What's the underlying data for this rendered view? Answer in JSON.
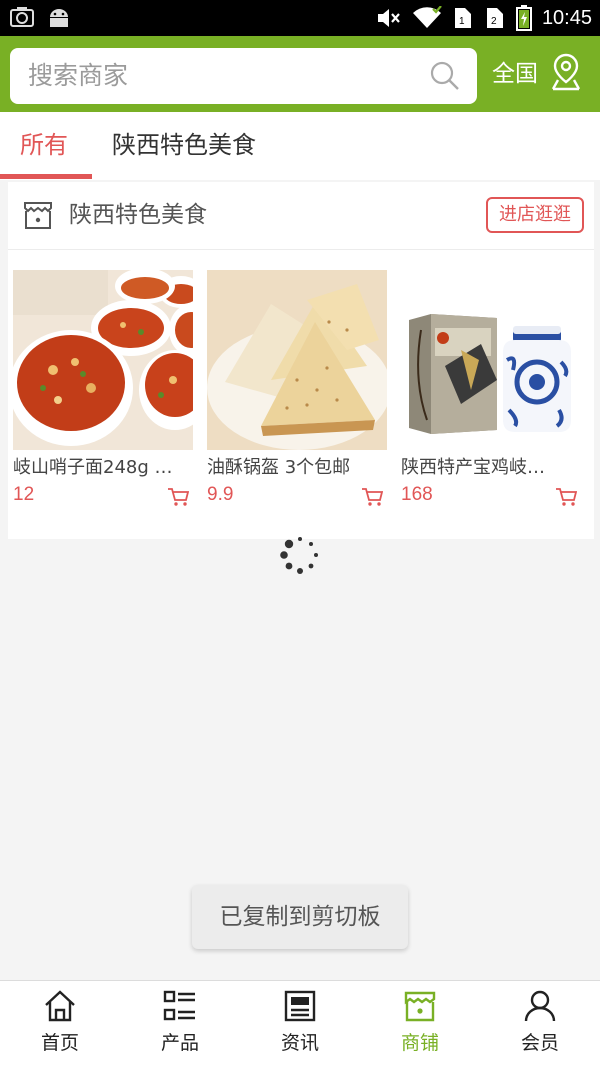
{
  "status_bar": {
    "time": "10:45",
    "icons": [
      "screenshot-icon",
      "android-icon",
      "mute-icon",
      "wifi-icon",
      "sim1-icon",
      "sim2-icon",
      "battery-icon"
    ]
  },
  "header": {
    "search_placeholder": "搜索商家",
    "region_label": "全国",
    "accent_color": "#79b025"
  },
  "tabs": [
    {
      "label": "所有",
      "active": true
    },
    {
      "label": "陕西特色美食",
      "active": false
    }
  ],
  "shop": {
    "name": "陕西特色美食",
    "visit_label": "进店逛逛",
    "products": [
      {
        "name": "岐山哨子面248g …",
        "price": "12"
      },
      {
        "name": "油酥锅盔 3个包邮",
        "price": "9.9"
      },
      {
        "name": "陕西特产宝鸡岐…",
        "price": "168"
      }
    ]
  },
  "toast": "已复制到剪切板",
  "bottom_nav": [
    {
      "label": "首页",
      "icon": "home-icon",
      "active": false
    },
    {
      "label": "产品",
      "icon": "list-icon",
      "active": false
    },
    {
      "label": "资讯",
      "icon": "news-icon",
      "active": false
    },
    {
      "label": "商铺",
      "icon": "store-icon",
      "active": true
    },
    {
      "label": "会员",
      "icon": "user-icon",
      "active": false
    }
  ],
  "colors": {
    "price": "#e15656",
    "accent": "#79b025"
  }
}
